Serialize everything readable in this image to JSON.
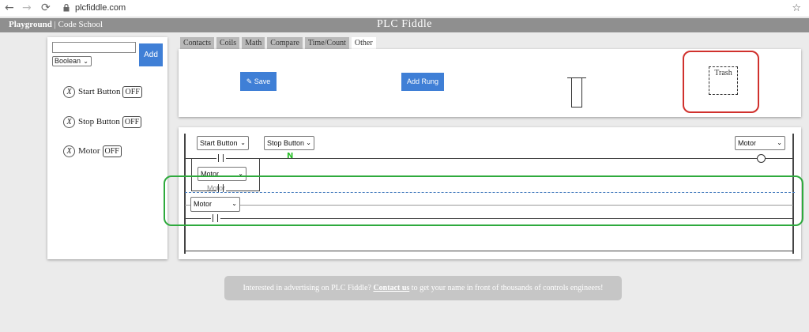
{
  "browser": {
    "url": "plcfiddle.com",
    "back_icon": "←",
    "forward_icon": "→",
    "reload_icon": "⟳",
    "star_icon": "☆"
  },
  "header": {
    "link_playground": "Playground",
    "separator": "|",
    "link_code_school": "Code School",
    "title": "PLC Fiddle"
  },
  "tag_panel": {
    "name_input_value": "",
    "type_select": "Boolean",
    "add_label": "Add",
    "remove_glyph": "X",
    "tags": [
      {
        "name": "Start Button",
        "state": "OFF"
      },
      {
        "name": "Stop Button",
        "state": "OFF"
      },
      {
        "name": "Motor",
        "state": "OFF"
      }
    ]
  },
  "tabs": [
    "Contacts",
    "Coils",
    "Math",
    "Compare",
    "Time/Count",
    "Other"
  ],
  "active_tab": "Other",
  "toolbox": {
    "save_label": "Save",
    "add_rung_label": "Add Rung",
    "trash_label": "Trash"
  },
  "ladder": {
    "rung1_contact_start": "Start Button",
    "rung1_contact_stop": "Stop Button",
    "rung1_coil": "Motor",
    "branch_contact": "Motor",
    "ghost_label": "Motor",
    "drag_element": "Motor",
    "nc_mark": "N"
  },
  "ad": {
    "prefix": "Interested in advertising on PLC Fiddle?",
    "link": "Contact us",
    "suffix": "to get your name in front of thousands of controls engineers!"
  },
  "colors": {
    "title_bar": "#8f8f8f",
    "button_blue": "#3f7fd6",
    "highlight_red": "#d0312d",
    "highlight_green": "#2eaa3d",
    "nc_green": "#2bbf2b"
  }
}
